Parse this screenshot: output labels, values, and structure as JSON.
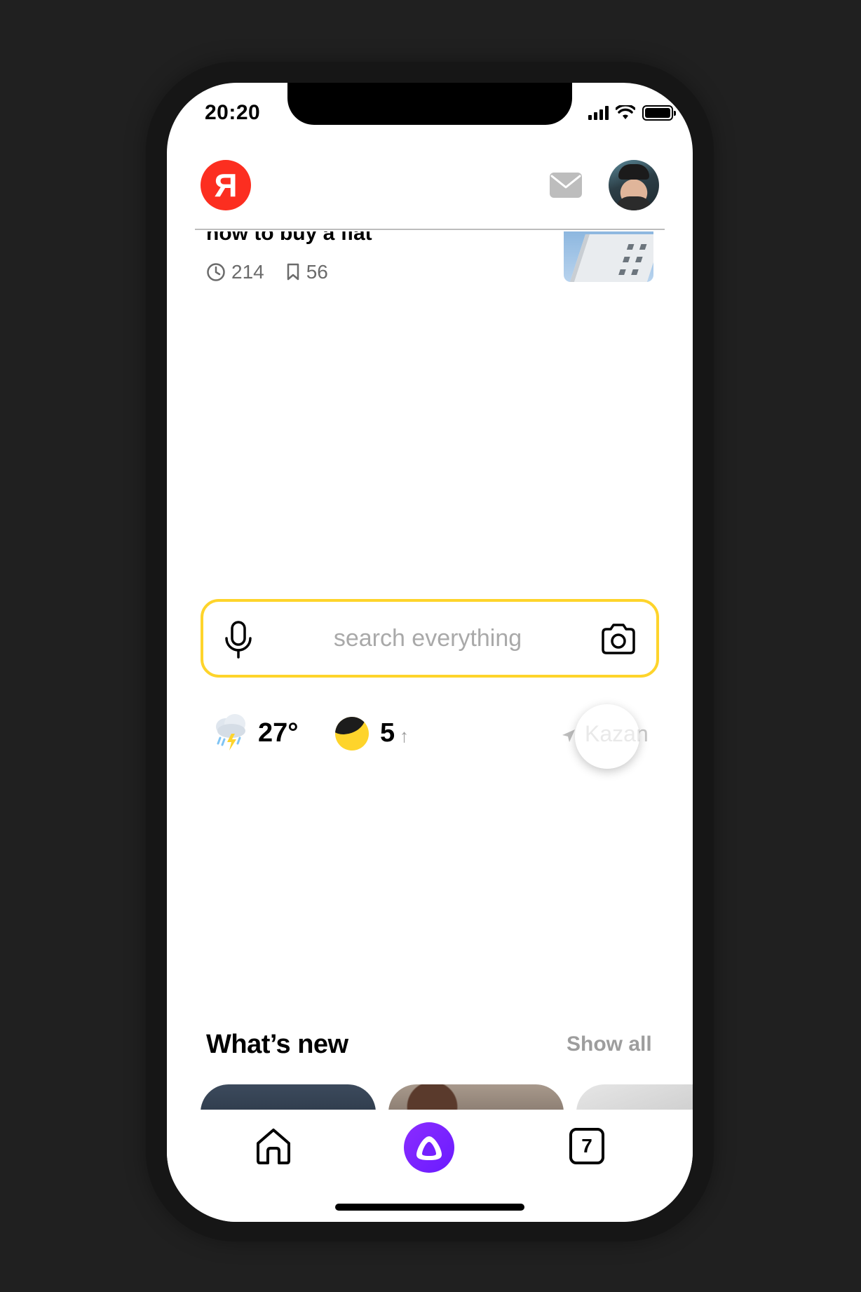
{
  "status_bar": {
    "time": "20:20",
    "icons": [
      "signal-icon",
      "wifi-icon",
      "battery-icon"
    ]
  },
  "header": {
    "logo_text": "Я",
    "logo_color": "#fc2e20",
    "mail_icon": "mail-icon",
    "avatar_icon": "avatar"
  },
  "article": {
    "title": "how to buy a flat",
    "views": "214",
    "bookmarks": "56"
  },
  "search": {
    "placeholder": "search everything",
    "value": "",
    "accent_color": "#fed42b"
  },
  "info": {
    "temperature": "27°",
    "weather_icon": "thunderstorm-icon",
    "traffic_level": "5",
    "traffic_trend": "↑",
    "city": "Kazan"
  },
  "whats_new": {
    "title": "What’s new",
    "show_all_label": "Show all"
  },
  "tabbar": {
    "tabs_count": "7",
    "alice_color": "#6a1bff"
  }
}
